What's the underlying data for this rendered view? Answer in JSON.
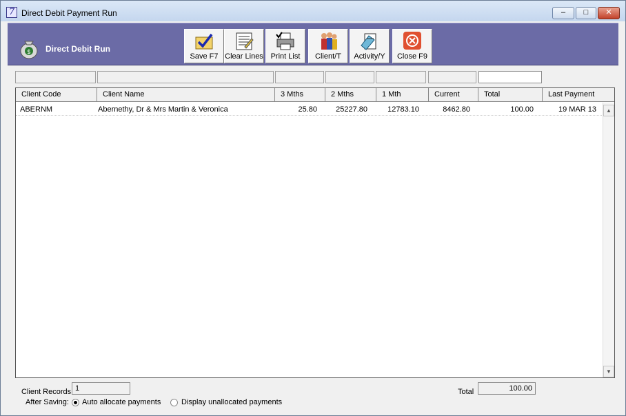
{
  "window": {
    "title": "Direct Debit Payment Run"
  },
  "titlebar_buttons": {
    "minimize": "–",
    "maximize": "□",
    "close": "✕"
  },
  "toolbar": {
    "title": "Direct Debit Run",
    "buttons": [
      {
        "label": "Save F7",
        "icon": "save-check-icon"
      },
      {
        "label": "Clear Lines",
        "icon": "clear-lines-icon"
      },
      {
        "label": "Print List",
        "icon": "printer-icon"
      },
      {
        "label": "Client/T",
        "icon": "clients-icon"
      },
      {
        "label": "Activity/Y",
        "icon": "activity-icon"
      },
      {
        "label": "Close F9",
        "icon": "close-circle-icon"
      }
    ]
  },
  "filters": [
    "",
    "",
    "",
    "",
    "",
    "",
    ""
  ],
  "table": {
    "columns": [
      "Client Code",
      "Client Name",
      "3 Mths",
      "2 Mths",
      "1 Mth",
      "Current",
      "Total",
      "Last Payment"
    ],
    "rows": [
      {
        "code": "ABERNM",
        "name": "Abernethy, Dr & Mrs Martin & Veronica",
        "m3": "25.80",
        "m2": "25227.80",
        "m1": "12783.10",
        "current": "8462.80",
        "total": "100.00",
        "last_payment": "19 MAR 13"
      }
    ]
  },
  "footer": {
    "client_records_label": "Client Records",
    "client_records_value": "1",
    "total_label": "Total",
    "total_value": "100.00",
    "after_saving_label": "After Saving:",
    "options": [
      {
        "label": "Auto allocate payments",
        "selected": true
      },
      {
        "label": "Display unallocated payments",
        "selected": false
      }
    ]
  }
}
